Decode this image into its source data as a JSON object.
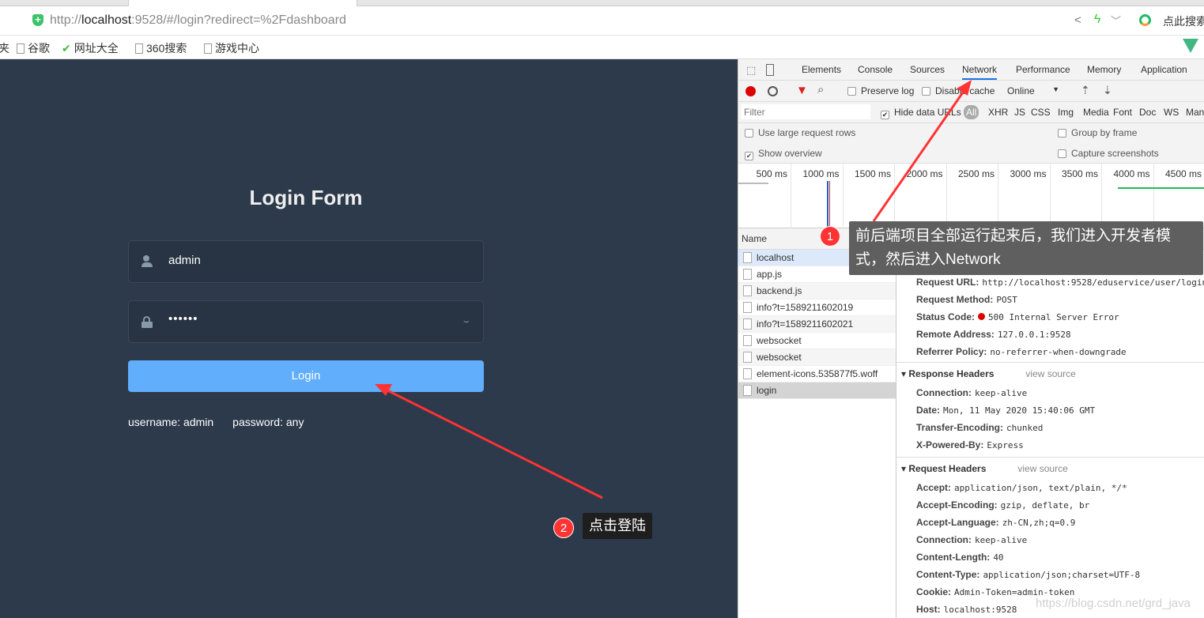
{
  "browser": {
    "url_prefix": "http://",
    "url_host": "localhost",
    "url_rest": ":9528/#/login?redirect=%2Fdashboard",
    "search_label": "点此搜索",
    "bookmarks": [
      "夹",
      "谷歌",
      "网址大全",
      "360搜索",
      "游戏中心"
    ]
  },
  "login": {
    "title": "Login Form",
    "username": "admin",
    "password": "••••••",
    "button": "Login",
    "tip_user": "username: admin",
    "tip_pass": "password: any",
    "bg_color": "#2d3a4b",
    "button_color": "#60aefc"
  },
  "devtools": {
    "tabs": [
      "Elements",
      "Console",
      "Sources",
      "Network",
      "Performance",
      "Memory",
      "Application"
    ],
    "active_tab": "Network",
    "toolbar": {
      "preserve_log": "Preserve log",
      "disable_cache": "Disable cache",
      "throttle": "Online"
    },
    "filter": {
      "placeholder": "Filter",
      "hide_data_urls": "Hide data URLs",
      "types": [
        "All",
        "XHR",
        "JS",
        "CSS",
        "Img",
        "Media",
        "Font",
        "Doc",
        "WS",
        "Manifest"
      ]
    },
    "options": {
      "large_rows": "Use large request rows",
      "show_overview": "Show overview",
      "group_by_frame": "Group by frame",
      "capture_screenshots": "Capture screenshots"
    },
    "timeline": [
      "500 ms",
      "1000 ms",
      "1500 ms",
      "2000 ms",
      "2500 ms",
      "3000 ms",
      "3500 ms",
      "4000 ms",
      "4500 ms"
    ],
    "name_header": "Name",
    "requests": [
      "localhost",
      "app.js",
      "backend.js",
      "info?t=1589211602019",
      "info?t=1589211602021",
      "websocket",
      "websocket",
      "element-icons.535877f5.woff",
      "login"
    ],
    "general": [
      {
        "k": "Request URL:",
        "v": "http://localhost:9528/eduservice/user/login"
      },
      {
        "k": "Request Method:",
        "v": "POST"
      },
      {
        "k": "Status Code:",
        "v": "500 Internal Server Error"
      },
      {
        "k": "Remote Address:",
        "v": "127.0.0.1:9528"
      },
      {
        "k": "Referrer Policy:",
        "v": "no-referrer-when-downgrade"
      }
    ],
    "response_title": "Response Headers",
    "view_source": "view source",
    "response": [
      {
        "k": "Connection:",
        "v": "keep-alive"
      },
      {
        "k": "Date:",
        "v": "Mon, 11 May 2020 15:40:06 GMT"
      },
      {
        "k": "Transfer-Encoding:",
        "v": "chunked"
      },
      {
        "k": "X-Powered-By:",
        "v": "Express"
      }
    ],
    "request_title": "Request Headers",
    "request": [
      {
        "k": "Accept:",
        "v": "application/json, text/plain, */*"
      },
      {
        "k": "Accept-Encoding:",
        "v": "gzip, deflate, br"
      },
      {
        "k": "Accept-Language:",
        "v": "zh-CN,zh;q=0.9"
      },
      {
        "k": "Connection:",
        "v": "keep-alive"
      },
      {
        "k": "Content-Length:",
        "v": "40"
      },
      {
        "k": "Content-Type:",
        "v": "application/json;charset=UTF-8"
      },
      {
        "k": "Cookie:",
        "v": "Admin-Token=admin-token"
      },
      {
        "k": "Host:",
        "v": "localhost:9528"
      }
    ]
  },
  "annotations": {
    "n1": "1",
    "text1": "前后端项目全部运行起来后，我们进入开发者模式，然后进入Network",
    "n2": "2",
    "text2": "点击登陆",
    "watermark": "https://blog.csdn.net/grd_java"
  }
}
